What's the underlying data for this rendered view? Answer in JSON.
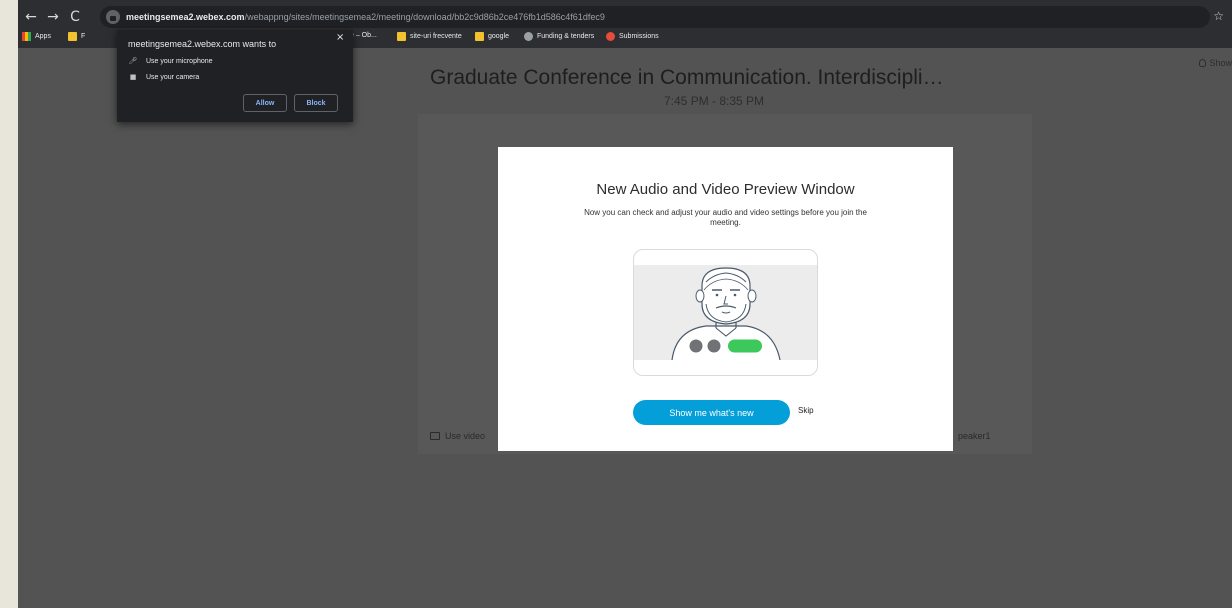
{
  "browser": {
    "url_host": "meetingsemea2.webex.com",
    "url_path": "/webappng/sites/meetingsemea2/meeting/download/bb2c9d86b2ce476fb1d586c4f61dfec9",
    "nav": {
      "back": "←",
      "forward": "→",
      "reload": "C"
    },
    "star_icon": "☆"
  },
  "bookmarks": [
    {
      "label": "Apps",
      "icon": "apps-grid-icon"
    },
    {
      "label": "F",
      "icon": "folder-icon"
    },
    {
      "label": "line – Ob...",
      "icon": "none"
    },
    {
      "label": "site-uri frecvente",
      "icon": "folder-icon"
    },
    {
      "label": "google",
      "icon": "folder-icon"
    },
    {
      "label": "Funding & tenders",
      "icon": "globe-icon"
    },
    {
      "label": "Submissions",
      "icon": "red-circle-icon"
    }
  ],
  "permission_popup": {
    "title": "meetingsemea2.webex.com wants to",
    "items": [
      {
        "label": "Use your microphone",
        "icon": "microphone-icon"
      },
      {
        "label": "Use your camera",
        "icon": "camera-icon"
      }
    ],
    "allow_label": "Allow",
    "block_label": "Block",
    "close_label": "×"
  },
  "meeting": {
    "title": "Graduate Conference in Communication. Interdiscipli…",
    "time": "7:45 PM - 8:35 PM",
    "show_link": "Show",
    "use_video_label": "Use video",
    "speaker_label": "peaker1"
  },
  "modal": {
    "title": "New Audio and Video Preview Window",
    "description": "Now you can check and adjust your audio and video settings before you join the meeting.",
    "primary_button": "Show me what's new",
    "skip": "Skip"
  },
  "colors": {
    "accent": "#049fd9",
    "green_toggle": "#3cc85a",
    "page_overlay": "#535353"
  }
}
